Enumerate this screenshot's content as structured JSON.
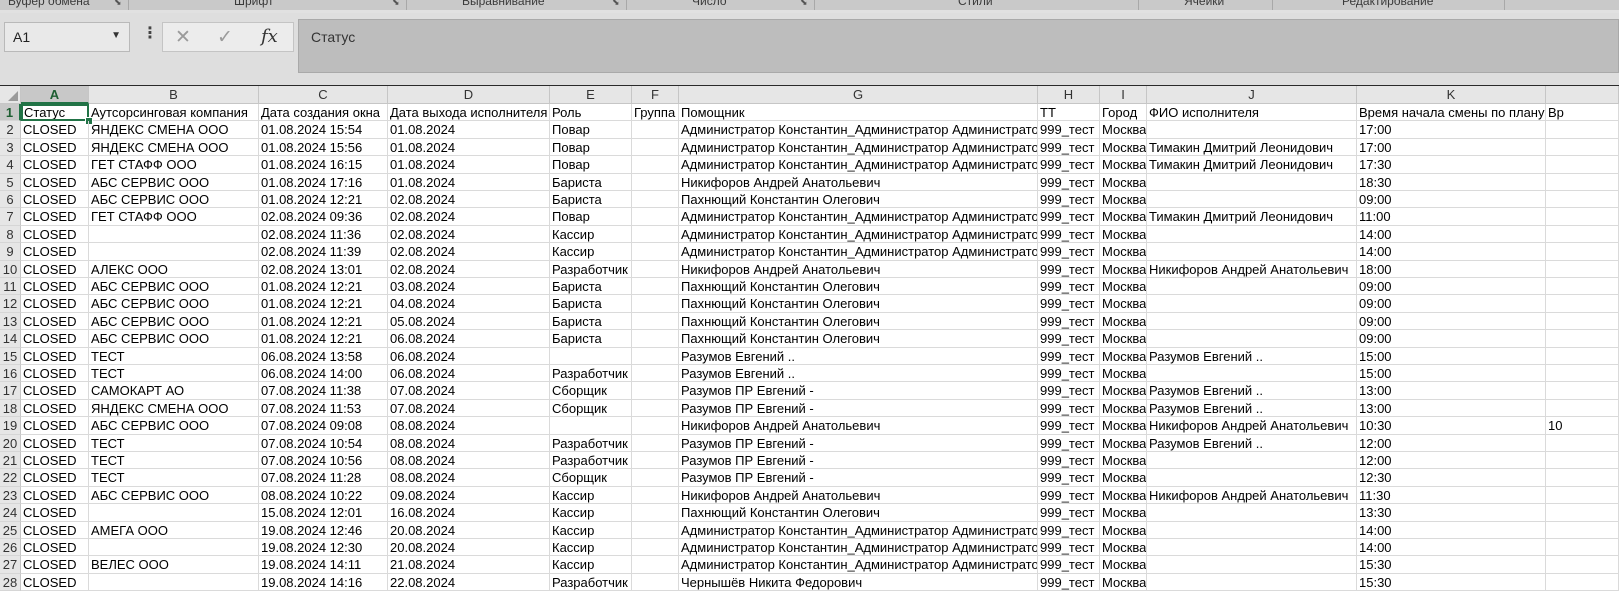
{
  "ribbon": {
    "groups": [
      "Буфер обмена",
      "Шрифт",
      "Выравнивание",
      "Число",
      "Стили",
      "Ячейки",
      "Редактирование"
    ]
  },
  "name_box": {
    "value": "A1"
  },
  "formula_bar": {
    "cancel_icon": "cross-icon",
    "enter_icon": "check-icon",
    "fx_label": "fx",
    "content": "Статус"
  },
  "sheet": {
    "columns": [
      "A",
      "B",
      "C",
      "D",
      "E",
      "F",
      "G",
      "H",
      "I",
      "J",
      "K"
    ],
    "headers": [
      "Статус",
      "Аутсорсинговая компания",
      "Дата создания окна",
      "Дата выхода исполнителя",
      "Роль",
      "Группа",
      "Помощник",
      "ТТ",
      "Город",
      "ФИО исполнителя",
      "Время начала смены по плану",
      "Вр"
    ],
    "rows": [
      {
        "n": "2",
        "c": [
          "CLOSED",
          "ЯНДЕКС СМЕНА ООО",
          "01.08.2024 15:54",
          "01.08.2024",
          "Повар",
          "",
          "Администратор Константин_Администратор Администратор",
          "999_тест",
          "Москва",
          "",
          "17:00",
          ""
        ]
      },
      {
        "n": "3",
        "c": [
          "CLOSED",
          "ЯНДЕКС СМЕНА ООО",
          "01.08.2024 15:56",
          "01.08.2024",
          "Повар",
          "",
          "Администратор Константин_Администратор Администратор",
          "999_тест",
          "Москва",
          "Тимакин Дмитрий Леонидович",
          "17:00",
          ""
        ]
      },
      {
        "n": "4",
        "c": [
          "CLOSED",
          "ГЕТ СТАФФ ООО",
          "01.08.2024 16:15",
          "01.08.2024",
          "Повар",
          "",
          "Администратор Константин_Администратор Администратор",
          "999_тест",
          "Москва",
          "Тимакин Дмитрий Леонидович",
          "17:30",
          ""
        ]
      },
      {
        "n": "5",
        "c": [
          "CLOSED",
          "АБС СЕРВИС ООО",
          "01.08.2024 17:16",
          "01.08.2024",
          "Бариста",
          "",
          "Никифоров Андрей Анатольевич",
          "999_тест",
          "Москва",
          "",
          "18:30",
          ""
        ]
      },
      {
        "n": "6",
        "c": [
          "CLOSED",
          "АБС СЕРВИС ООО",
          "01.08.2024 12:21",
          "02.08.2024",
          "Бариста",
          "",
          "Пахнющий Константин Олегович",
          "999_тест",
          "Москва",
          "",
          "09:00",
          ""
        ]
      },
      {
        "n": "7",
        "c": [
          "CLOSED",
          "ГЕТ СТАФФ ООО",
          "02.08.2024 09:36",
          "02.08.2024",
          "Повар",
          "",
          "Администратор Константин_Администратор Администратор",
          "999_тест",
          "Москва",
          "Тимакин Дмитрий Леонидович",
          "11:00",
          ""
        ]
      },
      {
        "n": "8",
        "c": [
          "CLOSED",
          "",
          "02.08.2024 11:36",
          "02.08.2024",
          "Кассир",
          "",
          "Администратор Константин_Администратор Администратор",
          "999_тест",
          "Москва",
          "",
          "14:00",
          ""
        ]
      },
      {
        "n": "9",
        "c": [
          "CLOSED",
          "",
          "02.08.2024 11:39",
          "02.08.2024",
          "Кассир",
          "",
          "Администратор Константин_Администратор Администратор",
          "999_тест",
          "Москва",
          "",
          "14:00",
          ""
        ]
      },
      {
        "n": "10",
        "c": [
          "CLOSED",
          "АЛЕКС ООО",
          "02.08.2024 13:01",
          "02.08.2024",
          "Разработчик",
          "",
          "Никифоров Андрей Анатольевич",
          "999_тест",
          "Москва",
          "Никифоров Андрей Анатольевич",
          "18:00",
          ""
        ]
      },
      {
        "n": "11",
        "c": [
          "CLOSED",
          "АБС СЕРВИС ООО",
          "01.08.2024 12:21",
          "03.08.2024",
          "Бариста",
          "",
          "Пахнющий Константин Олегович",
          "999_тест",
          "Москва",
          "",
          "09:00",
          ""
        ]
      },
      {
        "n": "12",
        "c": [
          "CLOSED",
          "АБС СЕРВИС ООО",
          "01.08.2024 12:21",
          "04.08.2024",
          "Бариста",
          "",
          "Пахнющий Константин Олегович",
          "999_тест",
          "Москва",
          "",
          "09:00",
          ""
        ]
      },
      {
        "n": "13",
        "c": [
          "CLOSED",
          "АБС СЕРВИС ООО",
          "01.08.2024 12:21",
          "05.08.2024",
          "Бариста",
          "",
          "Пахнющий Константин Олегович",
          "999_тест",
          "Москва",
          "",
          "09:00",
          ""
        ]
      },
      {
        "n": "14",
        "c": [
          "CLOSED",
          "АБС СЕРВИС ООО",
          "01.08.2024 12:21",
          "06.08.2024",
          "Бариста",
          "",
          "Пахнющий Константин Олегович",
          "999_тест",
          "Москва",
          "",
          "09:00",
          ""
        ]
      },
      {
        "n": "15",
        "c": [
          "CLOSED",
          "ТЕСТ",
          "06.08.2024 13:58",
          "06.08.2024",
          "",
          "",
          "Разумов Евгений ..",
          "999_тест",
          "Москва",
          "Разумов Евгений ..",
          "15:00",
          ""
        ]
      },
      {
        "n": "16",
        "c": [
          "CLOSED",
          "ТЕСТ",
          "06.08.2024 14:00",
          "06.08.2024",
          "Разработчик",
          "",
          "Разумов Евгений ..",
          "999_тест",
          "Москва",
          "",
          "15:00",
          ""
        ]
      },
      {
        "n": "17",
        "c": [
          "CLOSED",
          "САМОКАРТ АО",
          "07.08.2024 11:38",
          "07.08.2024",
          "Сборщик",
          "",
          "Разумов ПР Евгений -",
          "999_тест",
          "Москва",
          "Разумов Евгений ..",
          "13:00",
          ""
        ]
      },
      {
        "n": "18",
        "c": [
          "CLOSED",
          "ЯНДЕКС СМЕНА ООО",
          "07.08.2024 11:53",
          "07.08.2024",
          "Сборщик",
          "",
          "Разумов ПР Евгений -",
          "999_тест",
          "Москва",
          "Разумов Евгений ..",
          "13:00",
          ""
        ]
      },
      {
        "n": "19",
        "c": [
          "CLOSED",
          "АБС СЕРВИС ООО",
          "07.08.2024 09:08",
          "08.08.2024",
          "",
          "",
          "Никифоров Андрей Анатольевич",
          "999_тест",
          "Москва",
          "Никифоров Андрей Анатольевич",
          "10:30",
          "10"
        ]
      },
      {
        "n": "20",
        "c": [
          "CLOSED",
          "ТЕСТ",
          "07.08.2024 10:54",
          "08.08.2024",
          "Разработчик",
          "",
          "Разумов ПР Евгений -",
          "999_тест",
          "Москва",
          "Разумов Евгений ..",
          "12:00",
          ""
        ]
      },
      {
        "n": "21",
        "c": [
          "CLOSED",
          "ТЕСТ",
          "07.08.2024 10:56",
          "08.08.2024",
          "Разработчик",
          "",
          "Разумов ПР Евгений -",
          "999_тест",
          "Москва",
          "",
          "12:00",
          ""
        ]
      },
      {
        "n": "22",
        "c": [
          "CLOSED",
          "ТЕСТ",
          "07.08.2024 11:28",
          "08.08.2024",
          "Сборщик",
          "",
          "Разумов ПР Евгений -",
          "999_тест",
          "Москва",
          "",
          "12:30",
          ""
        ]
      },
      {
        "n": "23",
        "c": [
          "CLOSED",
          "АБС СЕРВИС ООО",
          "08.08.2024 10:22",
          "09.08.2024",
          "Кассир",
          "",
          "Никифоров Андрей Анатольевич",
          "999_тест",
          "Москва",
          "Никифоров Андрей Анатольевич",
          "11:30",
          ""
        ]
      },
      {
        "n": "24",
        "c": [
          "CLOSED",
          "",
          "15.08.2024 12:01",
          "16.08.2024",
          "Кассир",
          "",
          "Пахнющий Константин Олегович",
          "999_тест",
          "Москва",
          "",
          "13:30",
          ""
        ]
      },
      {
        "n": "25",
        "c": [
          "CLOSED",
          "АМЕГА ООО",
          "19.08.2024 12:46",
          "20.08.2024",
          "Кассир",
          "",
          "Администратор Константин_Администратор Администратор",
          "999_тест",
          "Москва",
          "",
          "14:00",
          ""
        ]
      },
      {
        "n": "26",
        "c": [
          "CLOSED",
          "",
          "19.08.2024 12:30",
          "20.08.2024",
          "Кассир",
          "",
          "Администратор Константин_Администратор Администратор",
          "999_тест",
          "Москва",
          "",
          "14:00",
          ""
        ]
      },
      {
        "n": "27",
        "c": [
          "CLOSED",
          "ВЕЛЕС ООО",
          "19.08.2024 14:11",
          "21.08.2024",
          "Кассир",
          "",
          "Администратор Константин_Администратор Администратор",
          "999_тест",
          "Москва",
          "",
          "15:30",
          ""
        ]
      },
      {
        "n": "28",
        "c": [
          "CLOSED",
          "",
          "19.08.2024 14:16",
          "22.08.2024",
          "Разработчик",
          "",
          "Чернышёв Никита Федорович",
          "999_тест",
          "Москва",
          "",
          "15:30",
          ""
        ]
      }
    ]
  }
}
